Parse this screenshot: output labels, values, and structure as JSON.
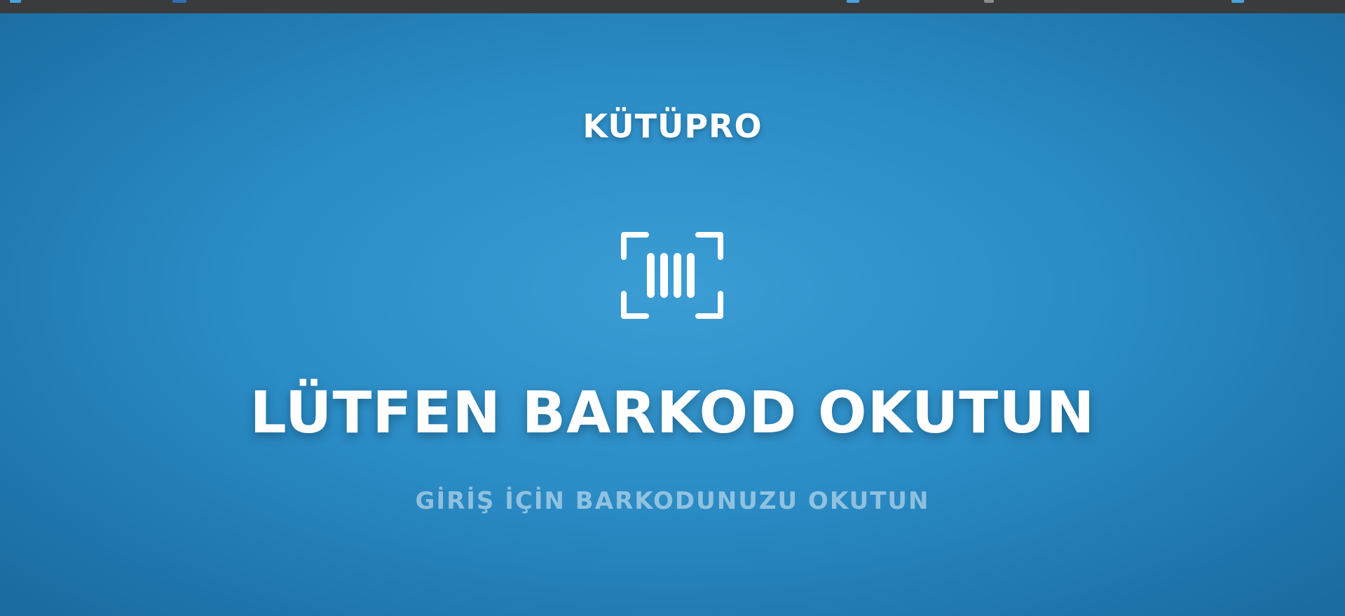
{
  "app": {
    "brand": "KÜTÜPRO"
  },
  "icons": {
    "scan": "barcode-scan-icon"
  },
  "main": {
    "headline": "LÜTFEN BARKOD OKUTUN",
    "subline": "GİRİŞ İÇİN BARKODUNUZU OKUTUN"
  },
  "colors": {
    "background_center": "#3b9dd4",
    "background_edge": "#1a6b9f",
    "text": "#ffffff",
    "topbar": "#3a3b3d"
  }
}
